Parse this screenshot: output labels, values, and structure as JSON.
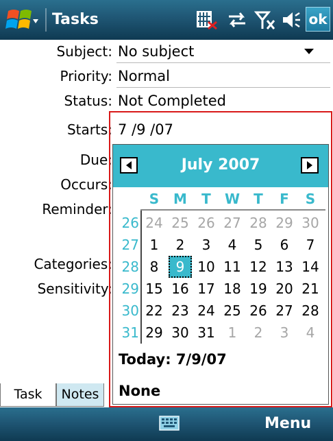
{
  "titlebar": {
    "title": "Tasks",
    "ok_label": "ok",
    "icons": [
      "windows-start-icon",
      "sim-card-icon",
      "sync-arrows-icon",
      "signal-off-icon",
      "volume-icon"
    ]
  },
  "form": {
    "subject": {
      "label": "Subject:",
      "value": "No subject"
    },
    "priority": {
      "label": "Priority:",
      "value": "Normal"
    },
    "status": {
      "label": "Status:",
      "value": "Not Completed"
    },
    "starts": {
      "label": "Starts:",
      "value": "7 /9 /07"
    },
    "due": {
      "label": "Due:"
    },
    "occurs": {
      "label": "Occurs:"
    },
    "reminder": {
      "label": "Reminder:"
    },
    "categories": {
      "label": "Categories:"
    },
    "sensitivity": {
      "label": "Sensitivity:"
    }
  },
  "calendar": {
    "month_title": "July 2007",
    "weekdays": [
      "S",
      "M",
      "T",
      "W",
      "T",
      "F",
      "S"
    ],
    "weeks": [
      {
        "num": "26",
        "days": [
          "24",
          "25",
          "26",
          "27",
          "28",
          "29",
          "30"
        ],
        "dim": [
          true,
          true,
          true,
          true,
          true,
          true,
          true
        ]
      },
      {
        "num": "27",
        "days": [
          "1",
          "2",
          "3",
          "4",
          "5",
          "6",
          "7"
        ],
        "dim": [
          false,
          false,
          false,
          false,
          false,
          false,
          false
        ]
      },
      {
        "num": "28",
        "days": [
          "8",
          "9",
          "10",
          "11",
          "12",
          "13",
          "14"
        ],
        "dim": [
          false,
          false,
          false,
          false,
          false,
          false,
          false
        ]
      },
      {
        "num": "29",
        "days": [
          "15",
          "16",
          "17",
          "18",
          "19",
          "20",
          "21"
        ],
        "dim": [
          false,
          false,
          false,
          false,
          false,
          false,
          false
        ]
      },
      {
        "num": "30",
        "days": [
          "22",
          "23",
          "24",
          "25",
          "26",
          "27",
          "28"
        ],
        "dim": [
          false,
          false,
          false,
          false,
          false,
          false,
          false
        ]
      },
      {
        "num": "31",
        "days": [
          "29",
          "30",
          "31",
          "1",
          "2",
          "3",
          "4"
        ],
        "dim": [
          false,
          false,
          false,
          true,
          true,
          true,
          true
        ]
      }
    ],
    "selected": "9",
    "today_label": "Today: 7/9/07",
    "none_label": "None",
    "accent": "#39b9cc"
  },
  "tabs": [
    {
      "label": "Task"
    },
    {
      "label": "Notes"
    }
  ],
  "menubar": {
    "menu_label": "Menu"
  },
  "colors": {
    "bar": "#1f5674",
    "accent": "#39b9cc",
    "highlight_frame": "#d81818"
  }
}
